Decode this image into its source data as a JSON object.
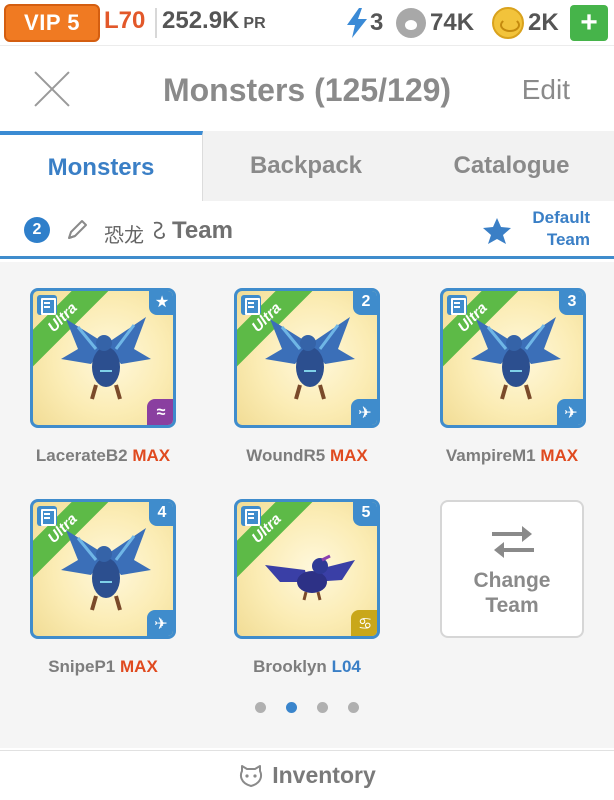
{
  "status_bar": {
    "vip_label": "VIP 5",
    "level": "L70",
    "power_value": "252.9K",
    "power_suffix": "PR",
    "energy": "3",
    "food": "74K",
    "gold": "2K",
    "add_label": "+"
  },
  "header": {
    "title": "Monsters (125/129)",
    "edit_label": "Edit"
  },
  "tabs": [
    {
      "label": "Monsters",
      "active": true
    },
    {
      "label": "Backpack",
      "active": false
    },
    {
      "label": "Catalogue",
      "active": false
    }
  ],
  "team_bar": {
    "team_number": "2",
    "team_name_prefix": "恐龙",
    "team_name": "Team",
    "default_line1": "Default",
    "default_line2": "Team"
  },
  "monsters": [
    {
      "name": "LacerateB2",
      "level": "MAX",
      "rarity": "Ultra",
      "slot": "★",
      "element_icon": "wave-icon",
      "element_glyph": "≈"
    },
    {
      "name": "WoundR5",
      "level": "MAX",
      "rarity": "Ultra",
      "slot": "2",
      "element_icon": "wind-icon",
      "element_glyph": "✈"
    },
    {
      "name": "VampireM1",
      "level": "MAX",
      "rarity": "Ultra",
      "slot": "3",
      "element_icon": "wind-icon",
      "element_glyph": "✈"
    },
    {
      "name": "SnipeP1",
      "level": "MAX",
      "rarity": "Ultra",
      "slot": "4",
      "element_icon": "wind-icon",
      "element_glyph": "✈"
    },
    {
      "name": "Brooklyn",
      "level": "L04",
      "rarity": "Ultra",
      "slot": "5",
      "element_icon": "spiral-icon",
      "element_glyph": "♋"
    }
  ],
  "change_team": {
    "line1": "Change",
    "line2": "Team"
  },
  "pager": {
    "total": 4,
    "active_index": 1
  },
  "footer": {
    "inventory_label": "Inventory"
  },
  "colors": {
    "accent": "#3a7fc6",
    "vip_orange": "#f07a22",
    "max_red": "#e04a1f",
    "ultra_green": "#5dba47",
    "plus_green": "#46b44a"
  }
}
